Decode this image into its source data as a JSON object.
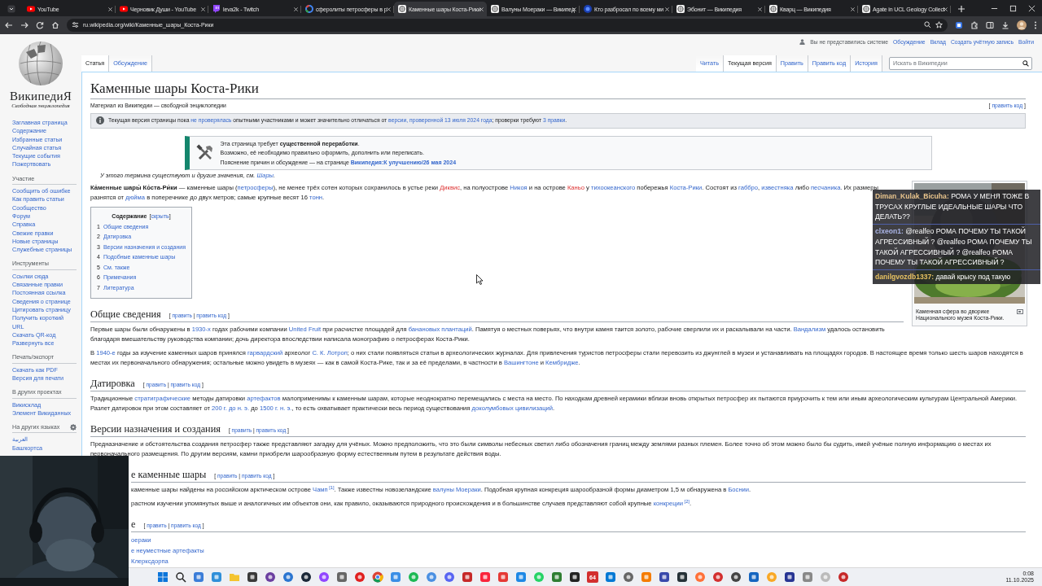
{
  "browser": {
    "tabs": [
      {
        "kind": "youtube",
        "title": "YouTube",
        "selected": false
      },
      {
        "kind": "youtube",
        "title": "Черновик Души - YouTube",
        "selected": false
      },
      {
        "kind": "twitch",
        "title": "leva2k - Twitch",
        "selected": false
      },
      {
        "kind": "google",
        "title": "сферолиты петросферы в р",
        "selected": false
      },
      {
        "kind": "wiki",
        "title": "Каменные шары Коста-Рики",
        "selected": true
      },
      {
        "kind": "wiki",
        "title": "Валуны Моераки — Википед",
        "selected": false
      },
      {
        "kind": "site",
        "title": "Кто разбросал по всему ми",
        "selected": false
      },
      {
        "kind": "wiki",
        "title": "Эбонит — Википедия",
        "selected": false
      },
      {
        "kind": "wiki",
        "title": "Кварц — Википедия",
        "selected": false
      },
      {
        "kind": "wiki",
        "title": "Agate in UCL Geology Collect",
        "selected": false
      }
    ],
    "url": "ru.wikipedia.org/wiki/Каменные_шары_Коста-Рики"
  },
  "wiki": {
    "logo": {
      "wordmark": "ВикипедиЯ",
      "tagline": "Свободная энциклопедия"
    },
    "sidebar": [
      {
        "items": [
          "Заглавная страница",
          "Содержание",
          "Избранные статьи",
          "Случайная статья",
          "Текущие события",
          "Пожертвовать"
        ]
      },
      {
        "heading": "Участие",
        "items": [
          "Сообщить об ошибке",
          "Как править статьи",
          "Сообщество",
          "Форум",
          "Справка",
          "Свежие правки",
          "Новые страницы",
          "Служебные страницы"
        ]
      },
      {
        "heading": "Инструменты",
        "items": [
          "Ссылки сюда",
          "Связанные правки",
          "Постоянная ссылка",
          "Сведения о странице",
          "Цитировать страницу",
          "Получить короткий URL",
          "Скачать QR-код",
          "Развернуть все"
        ]
      },
      {
        "heading": "Печать/экспорт",
        "items": [
          "Скачать как PDF",
          "Версия для печати"
        ]
      },
      {
        "heading": "В других проектах",
        "items": [
          "Викисклад",
          "Элемент Викиданных"
        ]
      },
      {
        "heading": "На других языках",
        "settings": true,
        "items": [
          "العربية",
          "Башҡортса"
        ]
      }
    ],
    "personal": {
      "status": "Вы не представились системе",
      "links": [
        "Обсуждение",
        "Вклад",
        "Создать учётную запись",
        "Войти"
      ]
    },
    "namespaces": [
      {
        "label": "Статья",
        "selected": true
      },
      {
        "label": "Обсуждение",
        "selected": false
      }
    ],
    "views": [
      {
        "label": "Читать",
        "selected": false
      },
      {
        "label": "Текущая версия",
        "selected": true
      },
      {
        "label": "Править",
        "selected": false
      },
      {
        "label": "Править код",
        "selected": false
      },
      {
        "label": "История",
        "selected": false
      }
    ],
    "search": {
      "placeholder": "Искать в Википедии"
    },
    "title": "Каменные шары Коста-Рики",
    "subtitle": "Материал из Википедии — свободной энциклопедии",
    "title_edit": [
      {
        "kind": "text",
        "text": "[ "
      },
      {
        "kind": "link",
        "text": "править код"
      },
      {
        "kind": "text",
        "text": " ]"
      }
    ],
    "notice": [
      {
        "kind": "text",
        "text": "Текущая версия страницы пока "
      },
      {
        "kind": "link",
        "text": "не проверялась"
      },
      {
        "kind": "text",
        "text": " опытными участниками и может значительно отличаться от "
      },
      {
        "kind": "link",
        "text": "версии, проверенной 13 июля 2024 года"
      },
      {
        "kind": "text",
        "text": "; проверки требуют "
      },
      {
        "kind": "link",
        "text": "3 правки"
      },
      {
        "kind": "text",
        "text": "."
      }
    ],
    "rework": [
      [
        {
          "kind": "text",
          "text": "Эта страница требует "
        },
        {
          "kind": "bold",
          "text": "существенной переработки"
        },
        {
          "kind": "text",
          "text": "."
        }
      ],
      [
        {
          "kind": "text",
          "text": "Возможно, её необходимо правильно оформить, дополнить или переписать."
        }
      ],
      [
        {
          "kind": "text",
          "text": "Пояснение причин и обсуждение — на странице "
        },
        {
          "kind": "boldlink",
          "text": "Википедия:К улучшению/26 мая 2024"
        }
      ]
    ],
    "hatnote": [
      {
        "kind": "text",
        "text": "У этого термина существуют и другие значения, см. "
      },
      {
        "kind": "link",
        "text": "Шары"
      },
      {
        "kind": "text",
        "text": "."
      }
    ],
    "lead": [
      {
        "kind": "bold",
        "text": "Ка́менные шары́ Ко́ста-Ри́ки"
      },
      {
        "kind": "text",
        "text": " — каменные шары ("
      },
      {
        "kind": "link",
        "text": "петросферы"
      },
      {
        "kind": "text",
        "text": "), не менее трёх сотен которых сохранилось в устье реки "
      },
      {
        "kind": "redlink",
        "text": "Диквис"
      },
      {
        "kind": "text",
        "text": ", на полуострове "
      },
      {
        "kind": "link",
        "text": "Никоя"
      },
      {
        "kind": "text",
        "text": " и на острове "
      },
      {
        "kind": "redlink",
        "text": "Каньо"
      },
      {
        "kind": "text",
        "text": " у "
      },
      {
        "kind": "link",
        "text": "тихоокеанского"
      },
      {
        "kind": "text",
        "text": " побережья "
      },
      {
        "kind": "link",
        "text": "Коста-Рики"
      },
      {
        "kind": "text",
        "text": ". Состоят из "
      },
      {
        "kind": "link",
        "text": "габбро"
      },
      {
        "kind": "text",
        "text": ", "
      },
      {
        "kind": "link",
        "text": "известняка"
      },
      {
        "kind": "text",
        "text": " либо "
      },
      {
        "kind": "link",
        "text": "песчаника"
      },
      {
        "kind": "text",
        "text": ". Их размеры разнятся от "
      },
      {
        "kind": "link",
        "text": "дюйма"
      },
      {
        "kind": "text",
        "text": " в поперечнике до двух метров; самые крупные весят 16 "
      },
      {
        "kind": "link",
        "text": "тонн"
      },
      {
        "kind": "text",
        "text": "."
      }
    ],
    "infobox": {
      "caption": "Каменная сфера во дворике Национального музея Коста-Рики."
    },
    "toc": {
      "title": "Содержание",
      "toggle": [
        {
          "kind": "text",
          "text": "["
        },
        {
          "kind": "link",
          "text": "скрыть"
        },
        {
          "kind": "text",
          "text": "]"
        }
      ],
      "items": [
        {
          "number": "1",
          "label": "Общие сведения"
        },
        {
          "number": "2",
          "label": "Датировка"
        },
        {
          "number": "3",
          "label": "Версии назначения и создания"
        },
        {
          "number": "4",
          "label": "Подобные каменные шары"
        },
        {
          "number": "5",
          "label": "См. также"
        },
        {
          "number": "6",
          "label": "Примечания"
        },
        {
          "number": "7",
          "label": "Литература"
        }
      ]
    },
    "sections": [
      {
        "title": "Общие сведения",
        "edit": [
          {
            "kind": "text",
            "text": "[ "
          },
          {
            "kind": "link",
            "text": "править"
          },
          {
            "kind": "text",
            "text": " | "
          },
          {
            "kind": "link",
            "text": "править код"
          },
          {
            "kind": "text",
            "text": " ]"
          }
        ],
        "blocks": [
          {
            "kind": "paragraph",
            "segments": [
              {
                "kind": "text",
                "text": "Первые шары были обнаружены в "
              },
              {
                "kind": "link",
                "text": "1930-х"
              },
              {
                "kind": "text",
                "text": " годах рабочими компании "
              },
              {
                "kind": "link",
                "text": "United Fruit"
              },
              {
                "kind": "text",
                "text": " при расчистке площадей для "
              },
              {
                "kind": "link",
                "text": "банановых плантаций"
              },
              {
                "kind": "text",
                "text": ". Памятуя о местных поверьях, что внутри камня таится золото, рабочие сверлили их и раскалывали на части. "
              },
              {
                "kind": "link",
                "text": "Вандализм"
              },
              {
                "kind": "text",
                "text": " удалось остановить благодаря вмешательству руководства компании; дочь директора впоследствии написала монографию о петросферах Коста-Рики."
              }
            ]
          },
          {
            "kind": "paragraph",
            "segments": [
              {
                "kind": "text",
                "text": "В "
              },
              {
                "kind": "link",
                "text": "1940-е"
              },
              {
                "kind": "text",
                "text": " годы за изучение каменных шаров принялся "
              },
              {
                "kind": "link",
                "text": "гарвардский"
              },
              {
                "kind": "text",
                "text": " археолог "
              },
              {
                "kind": "link",
                "text": "С. К. Лотроп"
              },
              {
                "kind": "text",
                "text": "; о них стали появляться статьи в археологических журналах. Для привлечения туристов петросферы стали перевозить из джунглей в музеи и устанавливать на площадях городов. В настоящее время только шесть шаров находятся в местах их первоначального обнаружения; остальные можно увидеть в музеях — как в самой Коста-Рике, так и за её пределами, в частности в "
              },
              {
                "kind": "link",
                "text": "Вашингтоне"
              },
              {
                "kind": "text",
                "text": " и "
              },
              {
                "kind": "link",
                "text": "Кембридже"
              },
              {
                "kind": "text",
                "text": "."
              }
            ]
          }
        ]
      },
      {
        "title": "Датировка",
        "edit": [
          {
            "kind": "text",
            "text": "[ "
          },
          {
            "kind": "link",
            "text": "править"
          },
          {
            "kind": "text",
            "text": " | "
          },
          {
            "kind": "link",
            "text": "править код"
          },
          {
            "kind": "text",
            "text": " ]"
          }
        ],
        "blocks": [
          {
            "kind": "paragraph",
            "segments": [
              {
                "kind": "text",
                "text": "Традиционные "
              },
              {
                "kind": "link",
                "text": "стратиграфические"
              },
              {
                "kind": "text",
                "text": " методы датировки "
              },
              {
                "kind": "link",
                "text": "артефактов"
              },
              {
                "kind": "text",
                "text": " малоприменимы к каменным шарам, которые неоднократно перемещались с места на место. По находкам древней керамики вблизи вновь открытых петросфер их пытаются приурочить к тем или иным археологическим культурам Центральной Америки. Разлет датировок при этом составляет от "
              },
              {
                "kind": "link",
                "text": "200 г. до н. э."
              },
              {
                "kind": "text",
                "text": " до "
              },
              {
                "kind": "link",
                "text": "1500 г. н. э."
              },
              {
                "kind": "text",
                "text": ", то есть охватывает практически весь период существования "
              },
              {
                "kind": "link",
                "text": "доколумбовых цивилизаций"
              },
              {
                "kind": "text",
                "text": "."
              }
            ]
          }
        ]
      },
      {
        "title": "Версии назначения и создания",
        "edit": [
          {
            "kind": "text",
            "text": "[ "
          },
          {
            "kind": "link",
            "text": "править"
          },
          {
            "kind": "text",
            "text": " | "
          },
          {
            "kind": "link",
            "text": "править код"
          },
          {
            "kind": "text",
            "text": " ]"
          }
        ],
        "blocks": [
          {
            "kind": "paragraph",
            "segments": [
              {
                "kind": "text",
                "text": "Предназначение и обстоятельства создания петросфер также представляют загадку для учёных. Можно предположить, что это были символы небесных светил либо обозначения границ между землями разных племен. Более точно об этом можно было бы судить, имей учёные полную информацию о местах их первоначального размещения. По другим версиям, камни приобрели шарообразную форму естественным путем в результате действия воды."
              }
            ]
          }
        ]
      },
      {
        "title": "е каменные шары",
        "edit": [
          {
            "kind": "text",
            "text": "[ "
          },
          {
            "kind": "link",
            "text": "править"
          },
          {
            "kind": "text",
            "text": " | "
          },
          {
            "kind": "link",
            "text": "править код"
          },
          {
            "kind": "text",
            "text": " ]"
          }
        ],
        "blocks": [
          {
            "kind": "paragraph",
            "segments": [
              {
                "kind": "text",
                "text": "каменные шары найдены на российском арктическом острове "
              },
              {
                "kind": "link",
                "text": "Чамп"
              },
              {
                "kind": "ref",
                "text": "[1]"
              },
              {
                "kind": "text",
                "text": ". Также известны новозеландские "
              },
              {
                "kind": "link",
                "text": "валуны Моераки"
              },
              {
                "kind": "text",
                "text": ". Подобная крупная конкреция шарообразной формы диаметром 1,5 м обнаружена в "
              },
              {
                "kind": "link",
                "text": "Боснии"
              },
              {
                "kind": "text",
                "text": "."
              }
            ]
          },
          {
            "kind": "paragraph",
            "segments": [
              {
                "kind": "text",
                "text": "растном изучении упомянутых выше и аналогичных им объектов они, как правило, оказываются природного происхождения и в большинстве случаев представляют собой крупные "
              },
              {
                "kind": "link",
                "text": "конкреции"
              },
              {
                "kind": "ref",
                "text": "[2]"
              },
              {
                "kind": "text",
                "text": "."
              }
            ]
          }
        ]
      },
      {
        "title": "е",
        "edit": [
          {
            "kind": "text",
            "text": "[ "
          },
          {
            "kind": "link",
            "text": "править"
          },
          {
            "kind": "text",
            "text": " | "
          },
          {
            "kind": "link",
            "text": "править код"
          },
          {
            "kind": "text",
            "text": " ]"
          }
        ],
        "blocks": [
          {
            "kind": "list",
            "items": [
              [
                {
                  "kind": "link",
                  "text": "оераки"
                }
              ],
              [
                {
                  "kind": "link",
                  "text": "е неуместные артефакты"
                }
              ],
              [
                {
                  "kind": "link",
                  "text": "Клерксдорпа"
                }
              ]
            ]
          }
        ]
      }
    ]
  },
  "chat": [
    {
      "user": "Diman_Kulak_Bicuha:",
      "color": "#e8c48c",
      "text": "РОМА У МЕНЯ ТОЖЕ В ТРУСАХ КРУГЛЫЕ ИДЕАЛЬНЫЕ ШАРЫ ЧТО ДЕЛАТЬ??"
    },
    {
      "user": "clxeon1:",
      "color": "#aab4e6",
      "text": "@realfeo РОМА ПОЧЕМУ ТЫ ТАКОЙ АГРЕССИВНЫЙ ? @realfeo РОМА ПОЧЕМУ ТЫ ТАКОЙ АГРЕССИВНЫЙ ? @realfeo РОМА ПОЧЕМУ ТЫ ТАКОЙ АГРЕССИВНЫЙ ?"
    },
    {
      "user": "danilgvozdb1337:",
      "color": "#e6c060",
      "text": "давай крысу под такую"
    }
  ],
  "taskbar": {
    "counter": "64",
    "time": "0:08",
    "date": "11.10.2025"
  }
}
